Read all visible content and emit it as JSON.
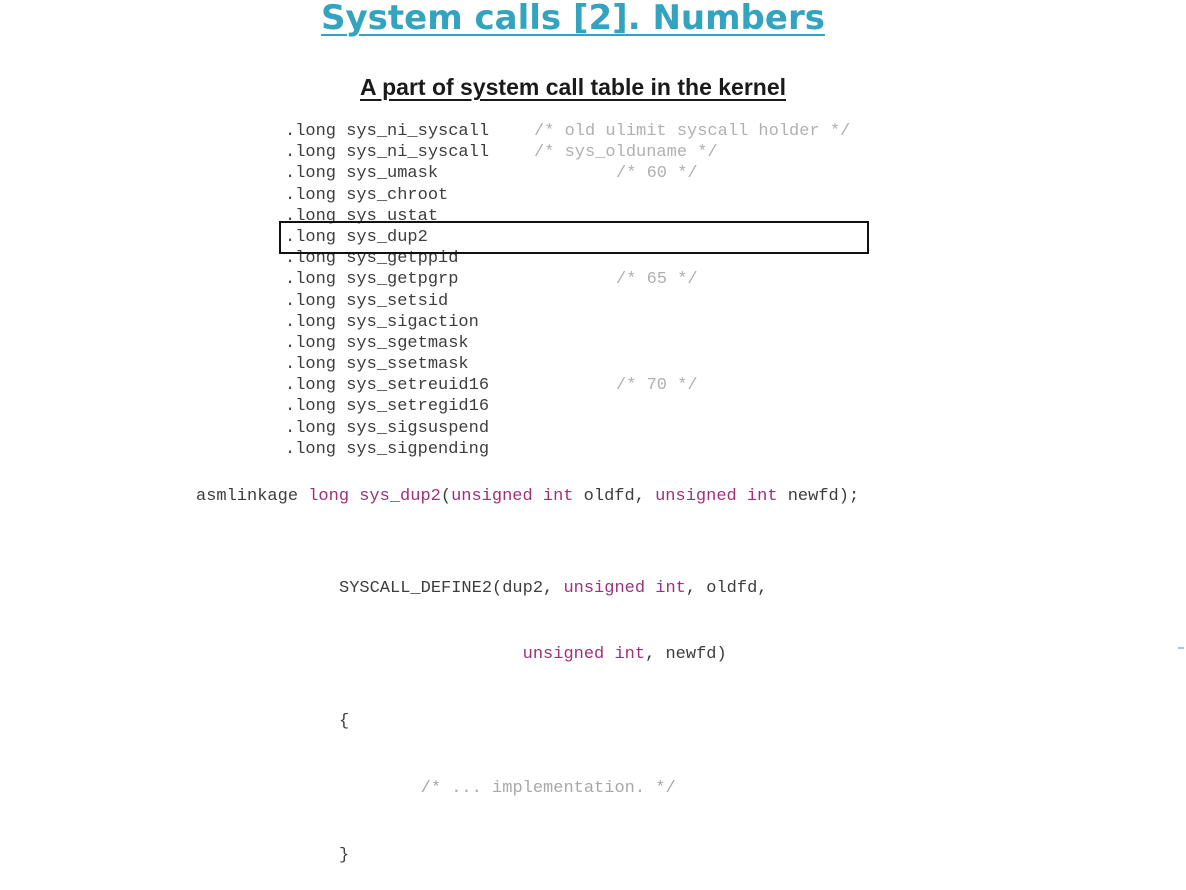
{
  "title": "System calls [2]. Numbers",
  "subtitle": "A part of system call table in the kernel",
  "syscall_table": [
    {
      "name": ".long sys_ni_syscall",
      "comment": "/* old ulimit syscall holder */"
    },
    {
      "name": ".long sys_ni_syscall",
      "comment": "/* sys_olduname */"
    },
    {
      "name": ".long sys_umask",
      "comment": "/* 60 */"
    },
    {
      "name": ".long sys_chroot",
      "comment": ""
    },
    {
      "name": ".long sys_ustat",
      "comment": ""
    },
    {
      "name": ".long sys_dup2",
      "comment": ""
    },
    {
      "name": ".long sys_getppid",
      "comment": ""
    },
    {
      "name": ".long sys_getpgrp",
      "comment": "/* 65 */"
    },
    {
      "name": ".long sys_setsid",
      "comment": ""
    },
    {
      "name": ".long sys_sigaction",
      "comment": ""
    },
    {
      "name": ".long sys_sgetmask",
      "comment": ""
    },
    {
      "name": ".long sys_ssetmask",
      "comment": ""
    },
    {
      "name": ".long sys_setreuid16",
      "comment": "/* 70 */"
    },
    {
      "name": ".long sys_setregid16",
      "comment": ""
    },
    {
      "name": ".long sys_sigsuspend",
      "comment": ""
    },
    {
      "name": ".long sys_sigpending",
      "comment": ""
    }
  ],
  "highlighted_row": 5,
  "declaration": {
    "prefix": "asmlinkage ",
    "ret_type": "long",
    "fn_name": "sys_dup2",
    "open": "(",
    "kw1": "unsigned int",
    "arg1": " oldfd, ",
    "kw2": "unsigned int",
    "arg2": " newfd);"
  },
  "define_block": {
    "line1_a": "SYSCALL_DEFINE2(dup2, ",
    "line1_kw": "unsigned int",
    "line1_b": ", oldfd,",
    "line2_indent": "                  ",
    "line2_kw": "unsigned int",
    "line2_b": ", newfd)",
    "open_brace": "{",
    "comment_indent": "        ",
    "comment": "/* ... implementation. */",
    "close_brace": "}"
  },
  "colors": {
    "title": "#33a3c0",
    "keyword": "#a0307a",
    "comment": "#b0b0b0"
  }
}
